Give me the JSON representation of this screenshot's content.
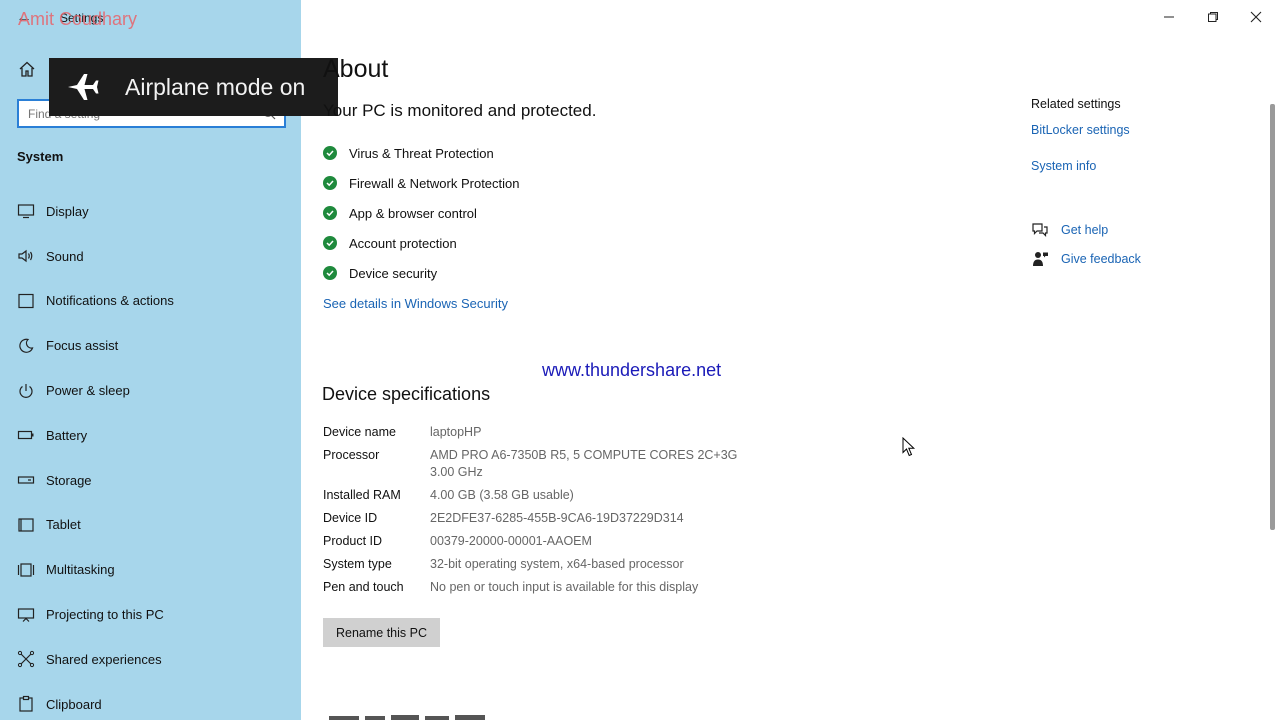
{
  "window": {
    "title": "Settings",
    "watermark_name": "Amit Coudhary"
  },
  "toast": {
    "label": "Airplane mode on"
  },
  "sidebar": {
    "search_placeholder": "Find a setting",
    "section": "System",
    "items": [
      {
        "label": "Display",
        "icon": "display-icon"
      },
      {
        "label": "Sound",
        "icon": "sound-icon"
      },
      {
        "label": "Notifications & actions",
        "icon": "notifications-icon"
      },
      {
        "label": "Focus assist",
        "icon": "focus-assist-icon"
      },
      {
        "label": "Power & sleep",
        "icon": "power-icon"
      },
      {
        "label": "Battery",
        "icon": "battery-icon"
      },
      {
        "label": "Storage",
        "icon": "storage-icon"
      },
      {
        "label": "Tablet",
        "icon": "tablet-icon"
      },
      {
        "label": "Multitasking",
        "icon": "multitasking-icon"
      },
      {
        "label": "Projecting to this PC",
        "icon": "projecting-icon"
      },
      {
        "label": "Shared experiences",
        "icon": "shared-experiences-icon"
      },
      {
        "label": "Clipboard",
        "icon": "clipboard-icon"
      }
    ]
  },
  "main": {
    "title": "About",
    "protect_title": "Your PC is monitored and protected.",
    "protections": [
      "Virus & Threat Protection",
      "Firewall & Network Protection",
      "App & browser control",
      "Account protection",
      "Device security"
    ],
    "security_link": "See details in Windows Security",
    "watermark_site": "www.thundershare.net",
    "specs_title": "Device specifications",
    "specs": [
      {
        "key": "Device name",
        "value": "laptopHP"
      },
      {
        "key": "Processor",
        "value": "AMD PRO A6-7350B R5, 5 COMPUTE CORES 2C+3G 3.00 GHz"
      },
      {
        "key": "Installed RAM",
        "value": "4.00 GB (3.58 GB usable)"
      },
      {
        "key": "Device ID",
        "value": "2E2DFE37-6285-455B-9CA6-19D37229D314"
      },
      {
        "key": "Product ID",
        "value": "00379-20000-00001-AAOEM"
      },
      {
        "key": "System type",
        "value": "32-bit operating system, x64-based processor"
      },
      {
        "key": "Pen and touch",
        "value": "No pen or touch input is available for this display"
      }
    ],
    "rename_button": "Rename this PC"
  },
  "related": {
    "title": "Related settings",
    "bitlocker": "BitLocker settings",
    "system_info": "System info",
    "get_help": "Get help",
    "give_feedback": "Give feedback"
  },
  "colors": {
    "sidebar_bg": "#a7d6eb",
    "link": "#1a64b4",
    "check": "#1f8a3d",
    "search_border": "#2a7fd6"
  }
}
